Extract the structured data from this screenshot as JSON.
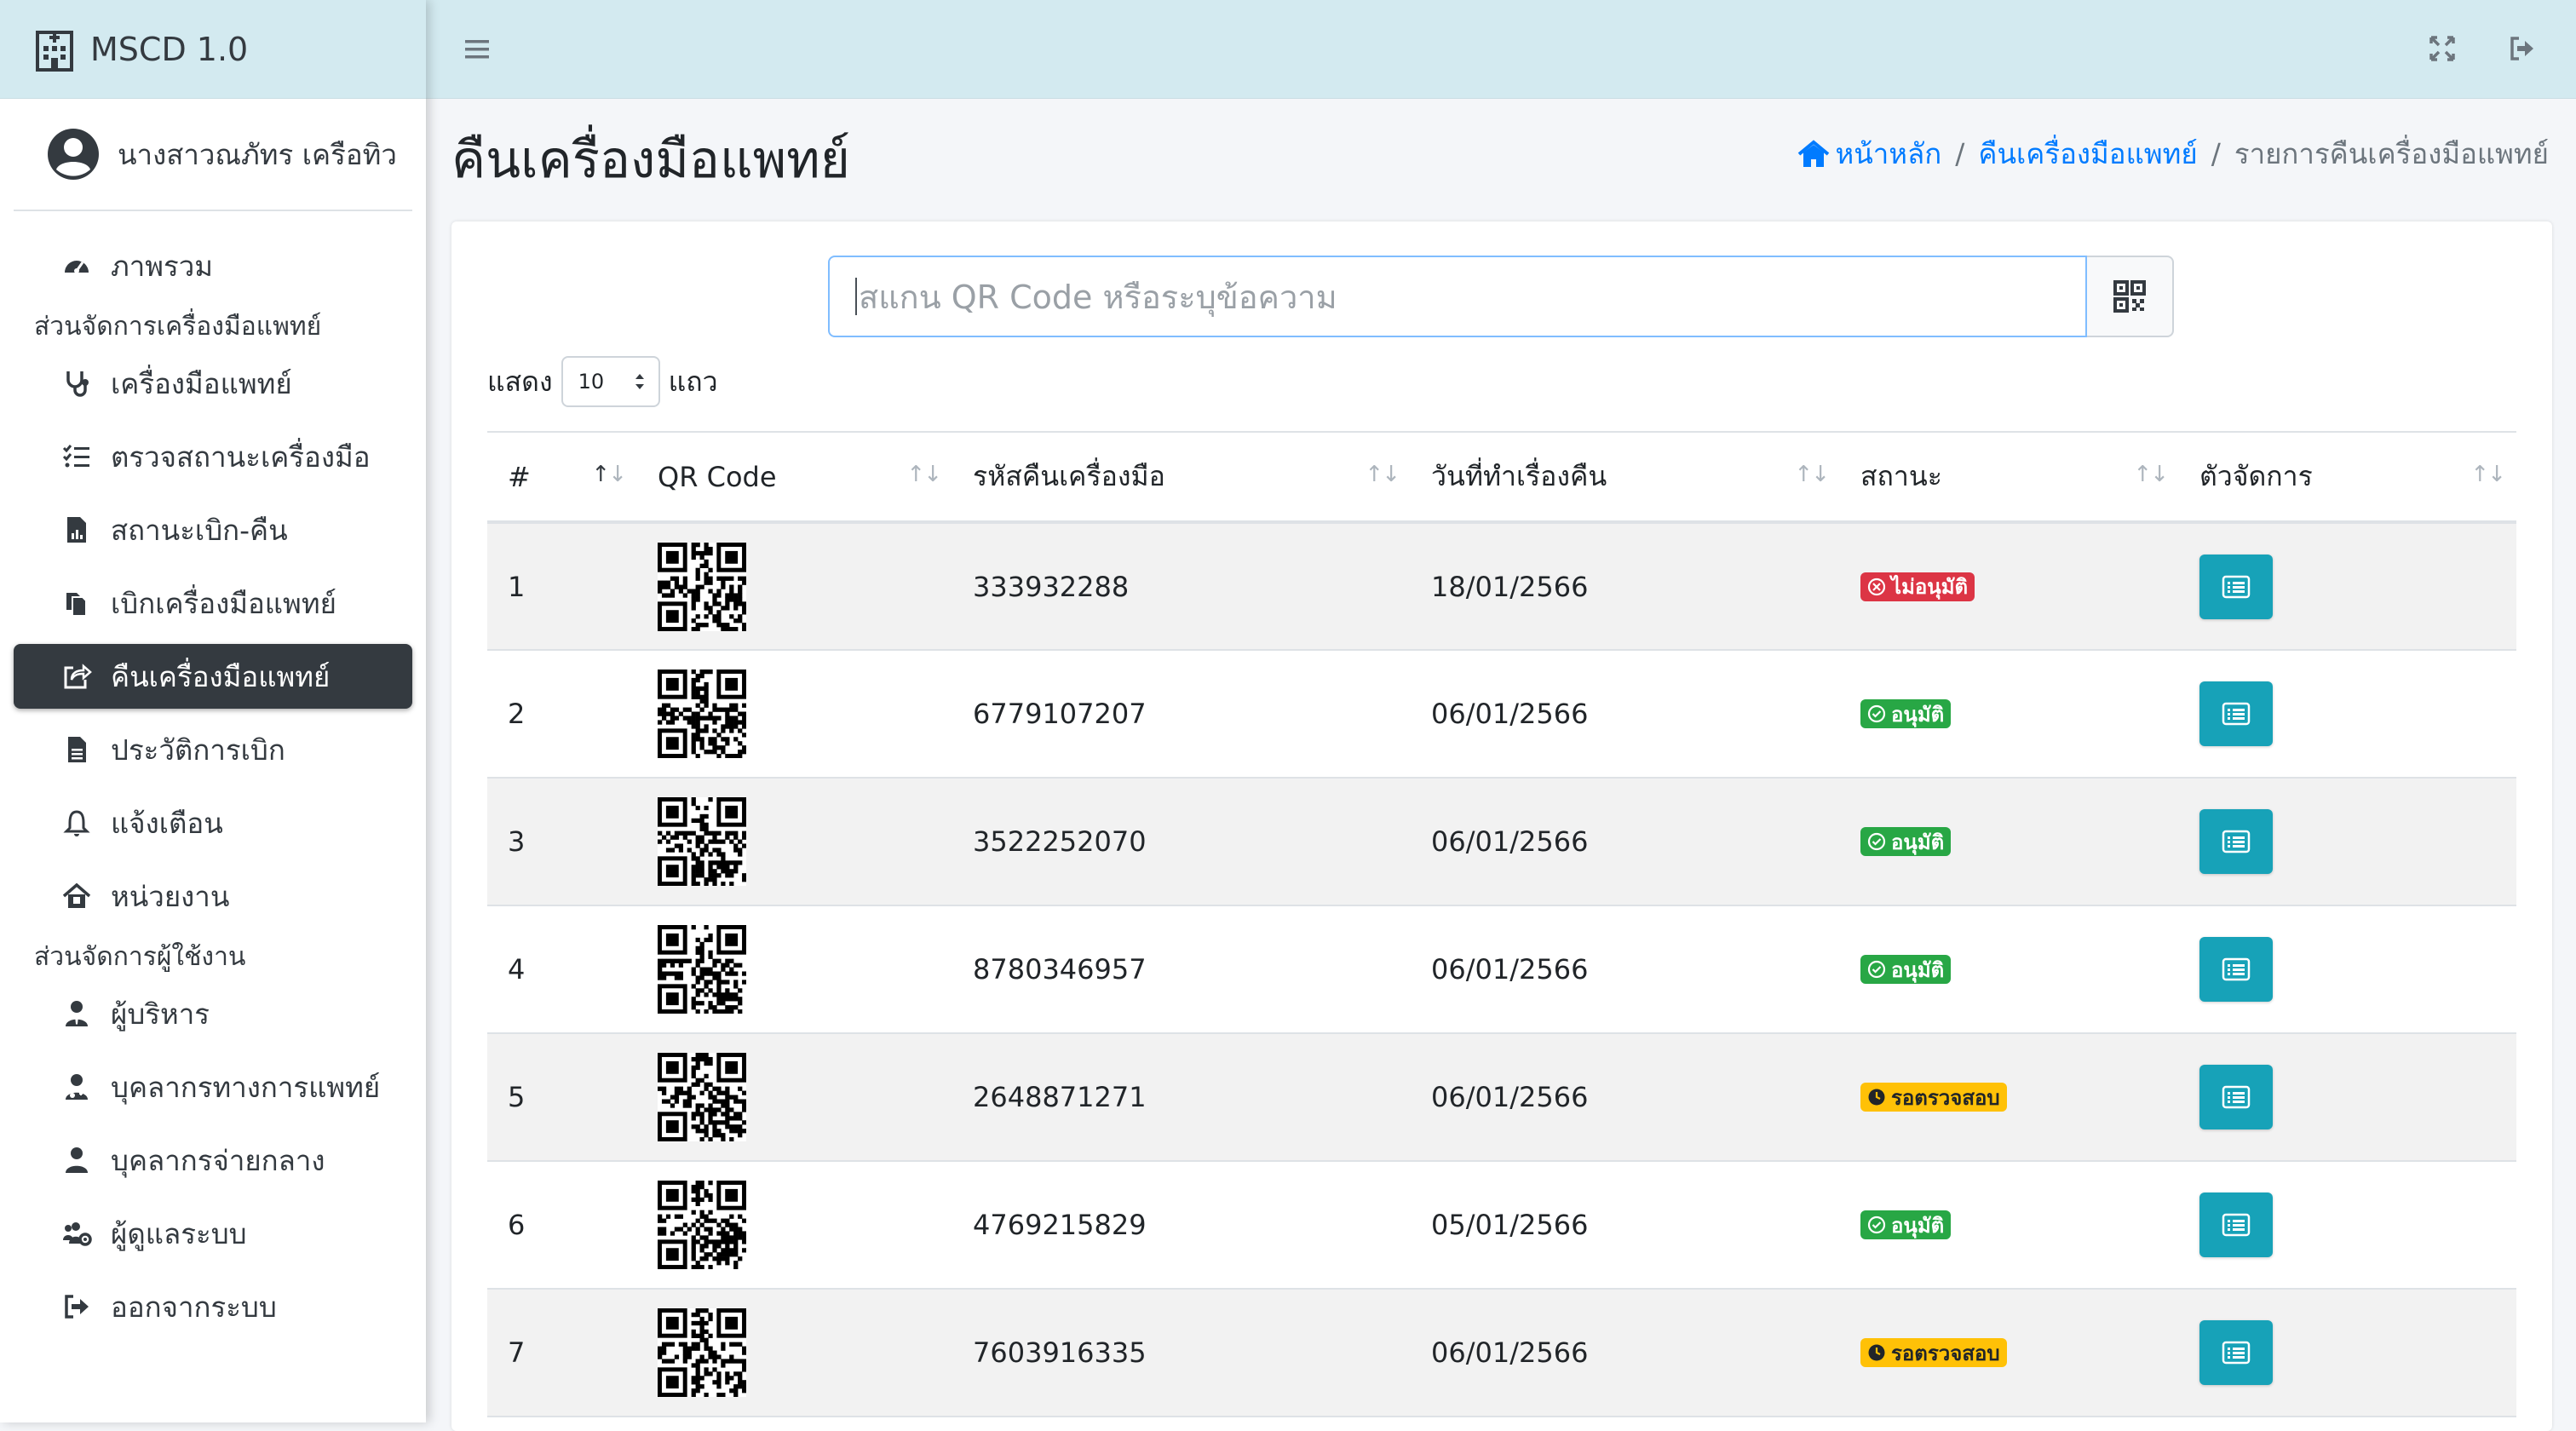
{
  "brand": {
    "title": "MSCD 1.0"
  },
  "user": {
    "name": "นางสาวณภัทร เครือทิว"
  },
  "sidebar": {
    "overview": "ภาพรวม",
    "section1": "ส่วนจัดการเครื่องมือแพทย์",
    "items1": [
      {
        "label": "เครื่องมือแพทย์",
        "icon": "stethoscope-icon"
      },
      {
        "label": "ตรวจสถานะเครื่องมือ",
        "icon": "list-check-icon"
      },
      {
        "label": "สถานะเบิก-คืน",
        "icon": "file-chart-icon"
      },
      {
        "label": "เบิกเครื่องมือแพทย์",
        "icon": "copy-icon"
      },
      {
        "label": "คืนเครื่องมือแพทย์",
        "icon": "share-square-icon"
      },
      {
        "label": "ประวัติการเบิก",
        "icon": "file-icon"
      },
      {
        "label": "แจ้งเตือน",
        "icon": "bell-icon"
      },
      {
        "label": "หน่วยงาน",
        "icon": "house-icon"
      }
    ],
    "section2": "ส่วนจัดการผู้ใช้งาน",
    "items2": [
      {
        "label": "ผู้บริหาร",
        "icon": "user-tie-icon"
      },
      {
        "label": "บุคลากรทางการแพทย์",
        "icon": "user-doctor-icon"
      },
      {
        "label": "บุคลากรจ่ายกลาง",
        "icon": "user-icon"
      },
      {
        "label": "ผู้ดูแลระบบ",
        "icon": "users-cog-icon"
      },
      {
        "label": "ออกจากระบบ",
        "icon": "sign-out-icon"
      }
    ]
  },
  "page": {
    "title": "คืนเครื่องมือแพทย์"
  },
  "breadcrumb": {
    "home": "หน้าหลัก",
    "section": "คืนเครื่องมือแพทย์",
    "current": "รายการคืนเครื่องมือแพทย์"
  },
  "search": {
    "placeholder": "สแกน QR Code หรือระบุข้อความ"
  },
  "length": {
    "prefix": "แสดง",
    "value": "10",
    "suffix": "แถว"
  },
  "table": {
    "headers": [
      "#",
      "QR Code",
      "รหัสคืนเครื่องมือ",
      "วันที่ทำเรื่องคืน",
      "สถานะ",
      "ตัวจัดการ"
    ],
    "rows": [
      {
        "no": "1",
        "code": "333932288",
        "date": "18/01/2566",
        "status": "ไม่อนุมัติ",
        "status_type": "rejected"
      },
      {
        "no": "2",
        "code": "6779107207",
        "date": "06/01/2566",
        "status": "อนุมัติ",
        "status_type": "approved"
      },
      {
        "no": "3",
        "code": "3522252070",
        "date": "06/01/2566",
        "status": "อนุมัติ",
        "status_type": "approved"
      },
      {
        "no": "4",
        "code": "8780346957",
        "date": "06/01/2566",
        "status": "อนุมัติ",
        "status_type": "approved"
      },
      {
        "no": "5",
        "code": "2648871271",
        "date": "06/01/2566",
        "status": "รอตรวจสอบ",
        "status_type": "pending"
      },
      {
        "no": "6",
        "code": "4769215829",
        "date": "05/01/2566",
        "status": "อนุมัติ",
        "status_type": "approved"
      },
      {
        "no": "7",
        "code": "7603916335",
        "date": "06/01/2566",
        "status": "รอตรวจสอบ",
        "status_type": "pending"
      }
    ]
  },
  "colors": {
    "accent": "#17a2b8",
    "topbar": "#d3eaf0",
    "active_nav": "#343a40",
    "link": "#007bff",
    "approved": "#28a745",
    "rejected": "#dc3545",
    "pending": "#ffc107"
  }
}
